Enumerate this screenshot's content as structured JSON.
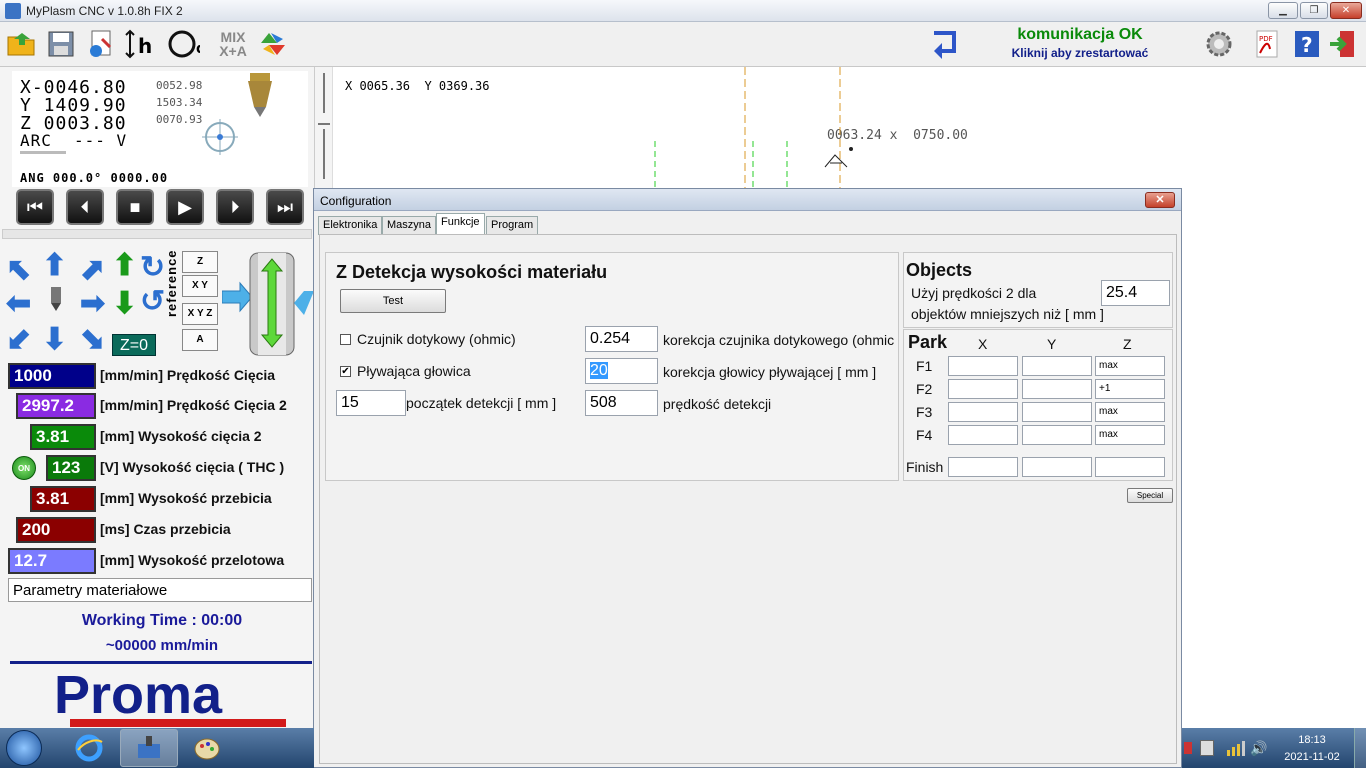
{
  "window": {
    "title": "MyPlasm CNC v 1.0.8h FIX 2",
    "min": "▁",
    "max": "❐",
    "close": "✕"
  },
  "toolbar": {
    "icons": [
      "open-folder-icon",
      "save-icon",
      "settings-doc-icon",
      "height-h-icon",
      "diameter-d-icon",
      "mix-xa-icon",
      "convert-icon"
    ],
    "mix_label": "MIX\nX+A",
    "status_line1": "komunikacja OK",
    "status_line2": "Kliknij aby zrestartować"
  },
  "dro": {
    "x": "X-0046.80",
    "y": "Y 1409.90",
    "z": "Z 0003.80",
    "arc": "ARC",
    "arc_val": "--- V",
    "x2": "0052.98",
    "y2": "1503.34",
    "z2": "0070.93",
    "ang": "ANG 000.0° 0000.00"
  },
  "canvas": {
    "coords": "X 0065.36  Y 0369.36",
    "marker": "0063.24 x  0750.00"
  },
  "reference": {
    "label": "reference",
    "z": "Z",
    "xy": "X Y",
    "xyz": "X Y Z",
    "a": "A",
    "z0": "Z=0"
  },
  "params": [
    {
      "value": "1000",
      "label": "[mm/min] Prędkość Cięcia",
      "color": "#00008a"
    },
    {
      "value": "2997.2",
      "label": "[mm/min] Prędkość Cięcia 2",
      "color": "#8a2be2"
    },
    {
      "value": "3.81",
      "label": "[mm] Wysokość cięcia 2",
      "color": "#0a8a0a"
    },
    {
      "value": "123",
      "label": "[V] Wysokość cięcia ( THC )",
      "color": "#0a7a0a"
    },
    {
      "value": "3.81",
      "label": "[mm] Wysokość przebicia",
      "color": "#8b0000"
    },
    {
      "value": "200",
      "label": "[ms] Czas przebicia",
      "color": "#8b0000"
    },
    {
      "value": "12.7",
      "label": "[mm] Wysokość przelotowa",
      "color": "#7b7bff"
    }
  ],
  "thc_toggle": "ON",
  "material": "Parametry materiałowe",
  "working_time": "Working Time : 00:00",
  "speed": "~00000 mm/min",
  "logo": "Proma",
  "dialog": {
    "title": "Configuration",
    "close": "✕",
    "tabs": [
      "Elektronika",
      "Maszyna",
      "Funkcje",
      "Program"
    ],
    "active_tab": "Funkcje",
    "zdet": {
      "heading": "Z Detekcja wysokości materiału",
      "test": "Test",
      "ohmic_label": "Czujnik dotykowy (ohmic)",
      "ohmic_checked": false,
      "ohmic_val": "0.254",
      "ohmic_corr": "korekcja czujnika dotykowego (ohmic",
      "float_label": "Pływająca głowica",
      "float_checked": true,
      "float_val": "20",
      "float_corr": "korekcja głowicy pływającej [ mm ]",
      "start_val": "15",
      "start_label": "początek detekcji [ mm ]",
      "speed_val": "508",
      "speed_label": "prędkość detekcji"
    },
    "objects": {
      "heading": "Objects",
      "desc1": "Użyj prędkości 2 dla",
      "desc2": "objektów mniejszych niż [ mm ]",
      "val": "25.4"
    },
    "park": {
      "heading": "Park",
      "cols": [
        "X",
        "Y",
        "Z"
      ],
      "rows": [
        {
          "label": "F1",
          "x": "",
          "y": "",
          "z": "max"
        },
        {
          "label": "F2",
          "x": "",
          "y": "",
          "z": "+1"
        },
        {
          "label": "F3",
          "x": "",
          "y": "",
          "z": "max"
        },
        {
          "label": "F4",
          "x": "",
          "y": "",
          "z": "max"
        }
      ],
      "finish": "Finish"
    },
    "special": "Special"
  },
  "tray": {
    "time": "18:13",
    "date": "2021-11-02"
  }
}
